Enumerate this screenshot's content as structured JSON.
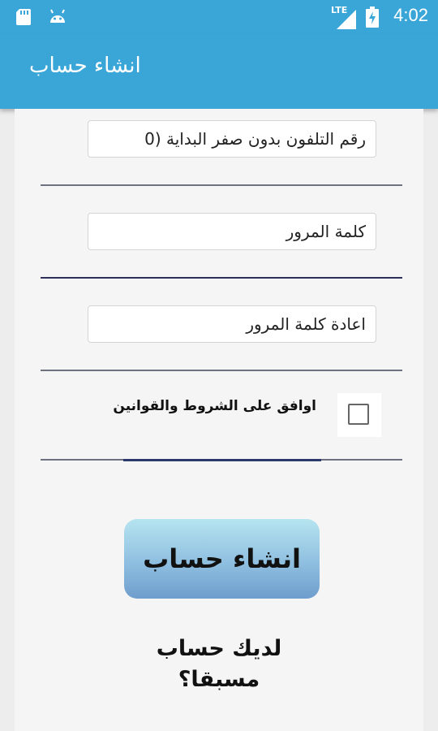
{
  "status_bar": {
    "time": "4:02",
    "network": "LTE",
    "icons": [
      "sd-card-icon",
      "android-icon",
      "signal-icon",
      "battery-charging-icon"
    ]
  },
  "app_bar": {
    "title": "انشاء حساب"
  },
  "form": {
    "phone_placeholder": "رقم التلفون بدون صفر البداية (0",
    "password_placeholder": "كلمة المرور",
    "confirm_password_placeholder": "اعادة كلمة المرور",
    "terms_label": "اوافق على الشروط والقوانين",
    "terms_checked": false
  },
  "actions": {
    "create_button": "انشاء حساب",
    "login_link_line1": "لديك حساب",
    "login_link_line2": "مسبقا؟"
  },
  "colors": {
    "app_bar": "#3aa6d8",
    "button_top": "#b6e4f0",
    "button_bottom": "#6f9dcd"
  }
}
